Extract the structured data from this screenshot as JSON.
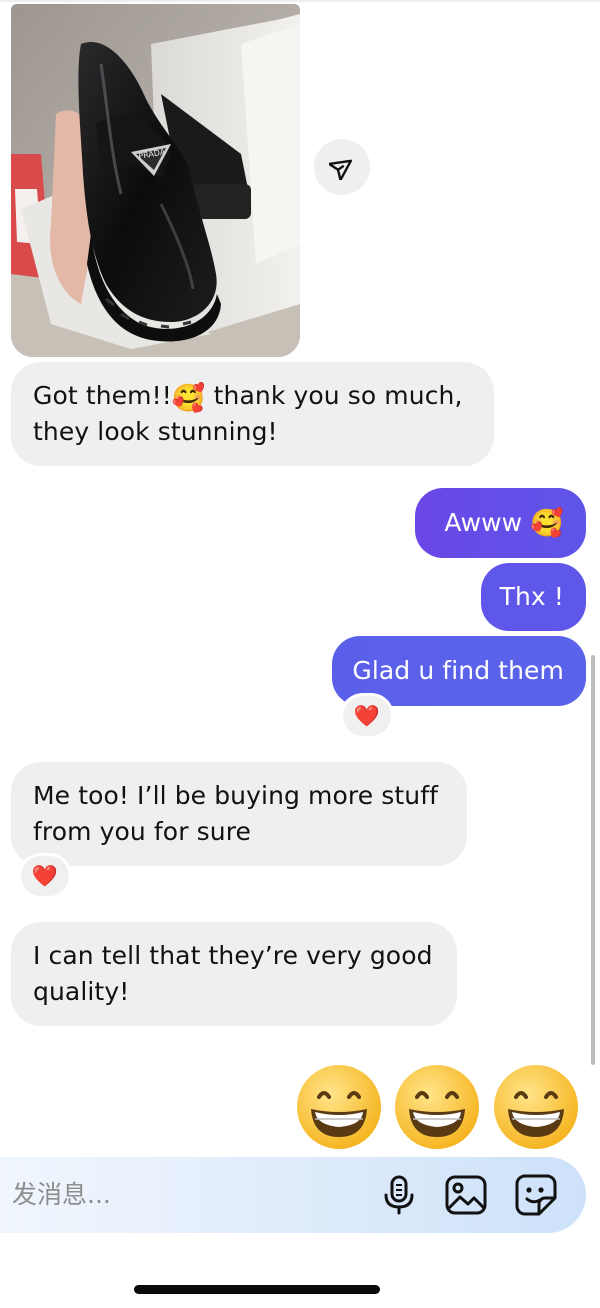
{
  "messages": [
    {
      "type": "photo",
      "direction": "received",
      "image_text": "PRADA"
    },
    {
      "type": "text",
      "direction": "received",
      "line1_before": "Got them!!",
      "line1_emoji": "🥰",
      "line1_after": " thank you so much,",
      "line2": "they look stunning!"
    },
    {
      "type": "text",
      "direction": "sent",
      "text": "Awww ",
      "emoji": "🥰"
    },
    {
      "type": "text",
      "direction": "sent",
      "text": "Thx !"
    },
    {
      "type": "text",
      "direction": "sent",
      "text": "Glad u find them",
      "reaction": "❤️"
    },
    {
      "type": "text",
      "direction": "received",
      "line1": "Me too! I’ll be buying more stuff",
      "line2": "from you for sure",
      "reaction": "❤️"
    },
    {
      "type": "text",
      "direction": "received",
      "line1": "I can tell that they’re very good",
      "line2": "quality!"
    },
    {
      "type": "emoji",
      "direction": "sent",
      "emojis": [
        "😁",
        "😁",
        "😁"
      ]
    }
  ],
  "composer": {
    "placeholder": "发消息...",
    "icons": [
      "microphone-icon",
      "image-icon",
      "sticker-icon"
    ]
  },
  "colors": {
    "sent_bubble_from": "#7a3fe6",
    "sent_bubble_to": "#5a5fe9",
    "received_bubble": "#efefef",
    "composer_gradient_start": "#f1f6fd",
    "composer_gradient_end": "#cde1f9"
  }
}
